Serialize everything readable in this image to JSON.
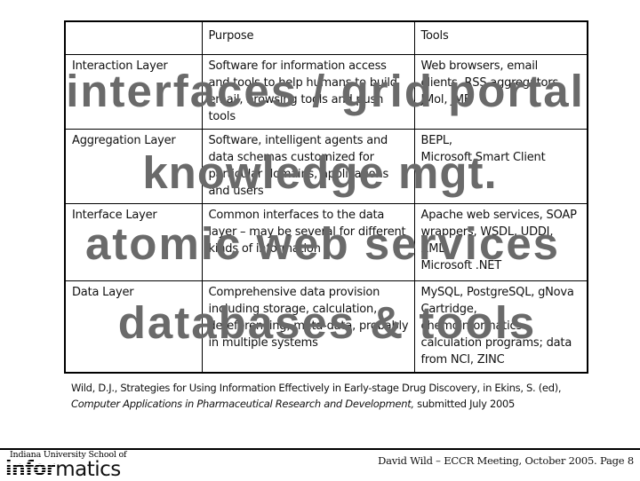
{
  "table": {
    "headers": [
      "",
      "Purpose",
      "Tools"
    ],
    "rows": [
      {
        "layer": "Interaction Layer",
        "purpose": "Software for information access and tools to help humans to build email, browsing tools and push tools",
        "tools": "Web browsers, email clients, RSS aggregators, JMol, JME"
      },
      {
        "layer": "Aggregation Layer",
        "purpose": "Software, intelligent agents and data schemas customized for particular domains, applications and users",
        "tools": "BEPL,\nMicrosoft Smart Client"
      },
      {
        "layer": "Interface Layer",
        "purpose": "Common interfaces to the data layer – may be several for different kinds of information",
        "tools": "Apache web services, SOAP wrappers, WSDL, UDDI, XML,\nMicrosoft .NET"
      },
      {
        "layer": "Data Layer",
        "purpose": "Comprehensive data provision including storage, calculation, dereferencing, meta-data, probably in multiple systems",
        "tools": "MySQL, PostgreSQL, gNova Cartridge, chemoinformatics calculation programs; data from NCI, ZINC"
      }
    ]
  },
  "overlays": [
    "interfaces / grid portal",
    "knowledge mgt.",
    "atomic web services",
    "databases & tools"
  ],
  "citation": {
    "line1": "Wild, D.J., Strategies for Using Information Effectively in Early-stage Drug Discovery, in Ekins, S. (ed),",
    "book_title": "Computer Applications in Pharmaceutical Research and Development,",
    "line2_suffix": " submitted July 2005"
  },
  "footer": {
    "logo_top": "Indiana University School of",
    "logo_striped": "infor",
    "logo_rest": "matics",
    "text": "David Wild – ECCR Meeting, October 2005.  Page 8"
  },
  "colors": {
    "overlay_text": "#6a6a6a",
    "rules": "#000000",
    "background": "#ffffff"
  }
}
